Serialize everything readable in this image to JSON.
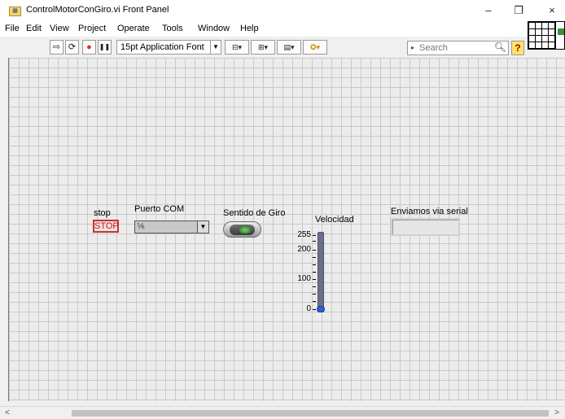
{
  "window": {
    "title": "ControlMotorConGiro.vi Front Panel",
    "icon": "labview-vi-icon",
    "controls": {
      "minimize": "–",
      "restore": "❐",
      "close": "×"
    }
  },
  "menu": {
    "items": [
      "File",
      "Edit",
      "View",
      "Project",
      "Operate",
      "Tools",
      "Window",
      "Help"
    ]
  },
  "toolbar": {
    "run_icon": "⇨",
    "run_continuously_icon": "⟳",
    "abort_icon": "●",
    "pause_icon": "❚❚",
    "font_label": "15pt Application Font",
    "align_icon": "align-objects-icon",
    "distribute_icon": "distribute-objects-icon",
    "resize_icon": "resize-objects-icon",
    "reorder_icon": "reorder-icon",
    "search_placeholder": "Search",
    "help_label": "?"
  },
  "panel": {
    "stop": {
      "label": "stop",
      "button_text": "STOP"
    },
    "visa": {
      "label": "Puerto COM",
      "value": ""
    },
    "toggle": {
      "label": "Sentido de Giro"
    },
    "slider": {
      "label": "Velocidad",
      "ticks": [
        "255",
        "200",
        "100",
        "0"
      ],
      "min": 0,
      "max": 255,
      "value": 0,
      "fill_color": "#6b6f8d",
      "thumb_color": "#2a63d6"
    },
    "indicator": {
      "label": "Enviamos via serial",
      "value": ""
    }
  },
  "scrollbar": {
    "left_arrow": "<",
    "right_arrow": ">"
  }
}
